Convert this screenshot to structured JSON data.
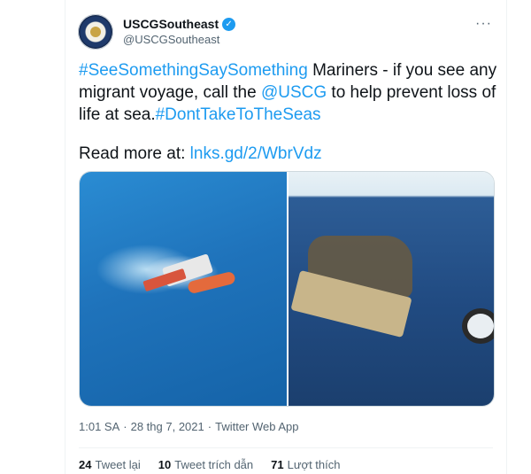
{
  "tweet": {
    "author": {
      "name": "USCGSoutheast",
      "handle": "@USCGSoutheast",
      "verified_icon": "verified-badge-icon",
      "avatar_icon": "uscg-seal-avatar"
    },
    "more_icon": "···",
    "body": {
      "hashtag1": "#SeeSomethingSaySomething",
      "text1": " Mariners - if you see any migrant voyage, call the ",
      "mention": "@USCG",
      "text2": " to help prevent loss of life at sea.",
      "hashtag2": "#DontTakeToTheSeas"
    },
    "read_more": {
      "label": "Read more at: ",
      "link": "lnks.gd/2/WbrVdz"
    },
    "media": {
      "photos": [
        "boats-at-sea-photo",
        "migrants-on-raft-photo"
      ]
    },
    "meta": {
      "time": "1:01 SA",
      "sep": "·",
      "date": "28 thg 7, 2021",
      "source": "Twitter Web App"
    },
    "stats": {
      "retweets": "24",
      "retweets_label": "Tweet lại",
      "quotes": "10",
      "quotes_label": "Tweet trích dẫn",
      "likes": "71",
      "likes_label": "Lượt thích"
    }
  },
  "colors": {
    "link": "#1d9bf0",
    "text": "#0f1419",
    "muted": "#536471"
  }
}
